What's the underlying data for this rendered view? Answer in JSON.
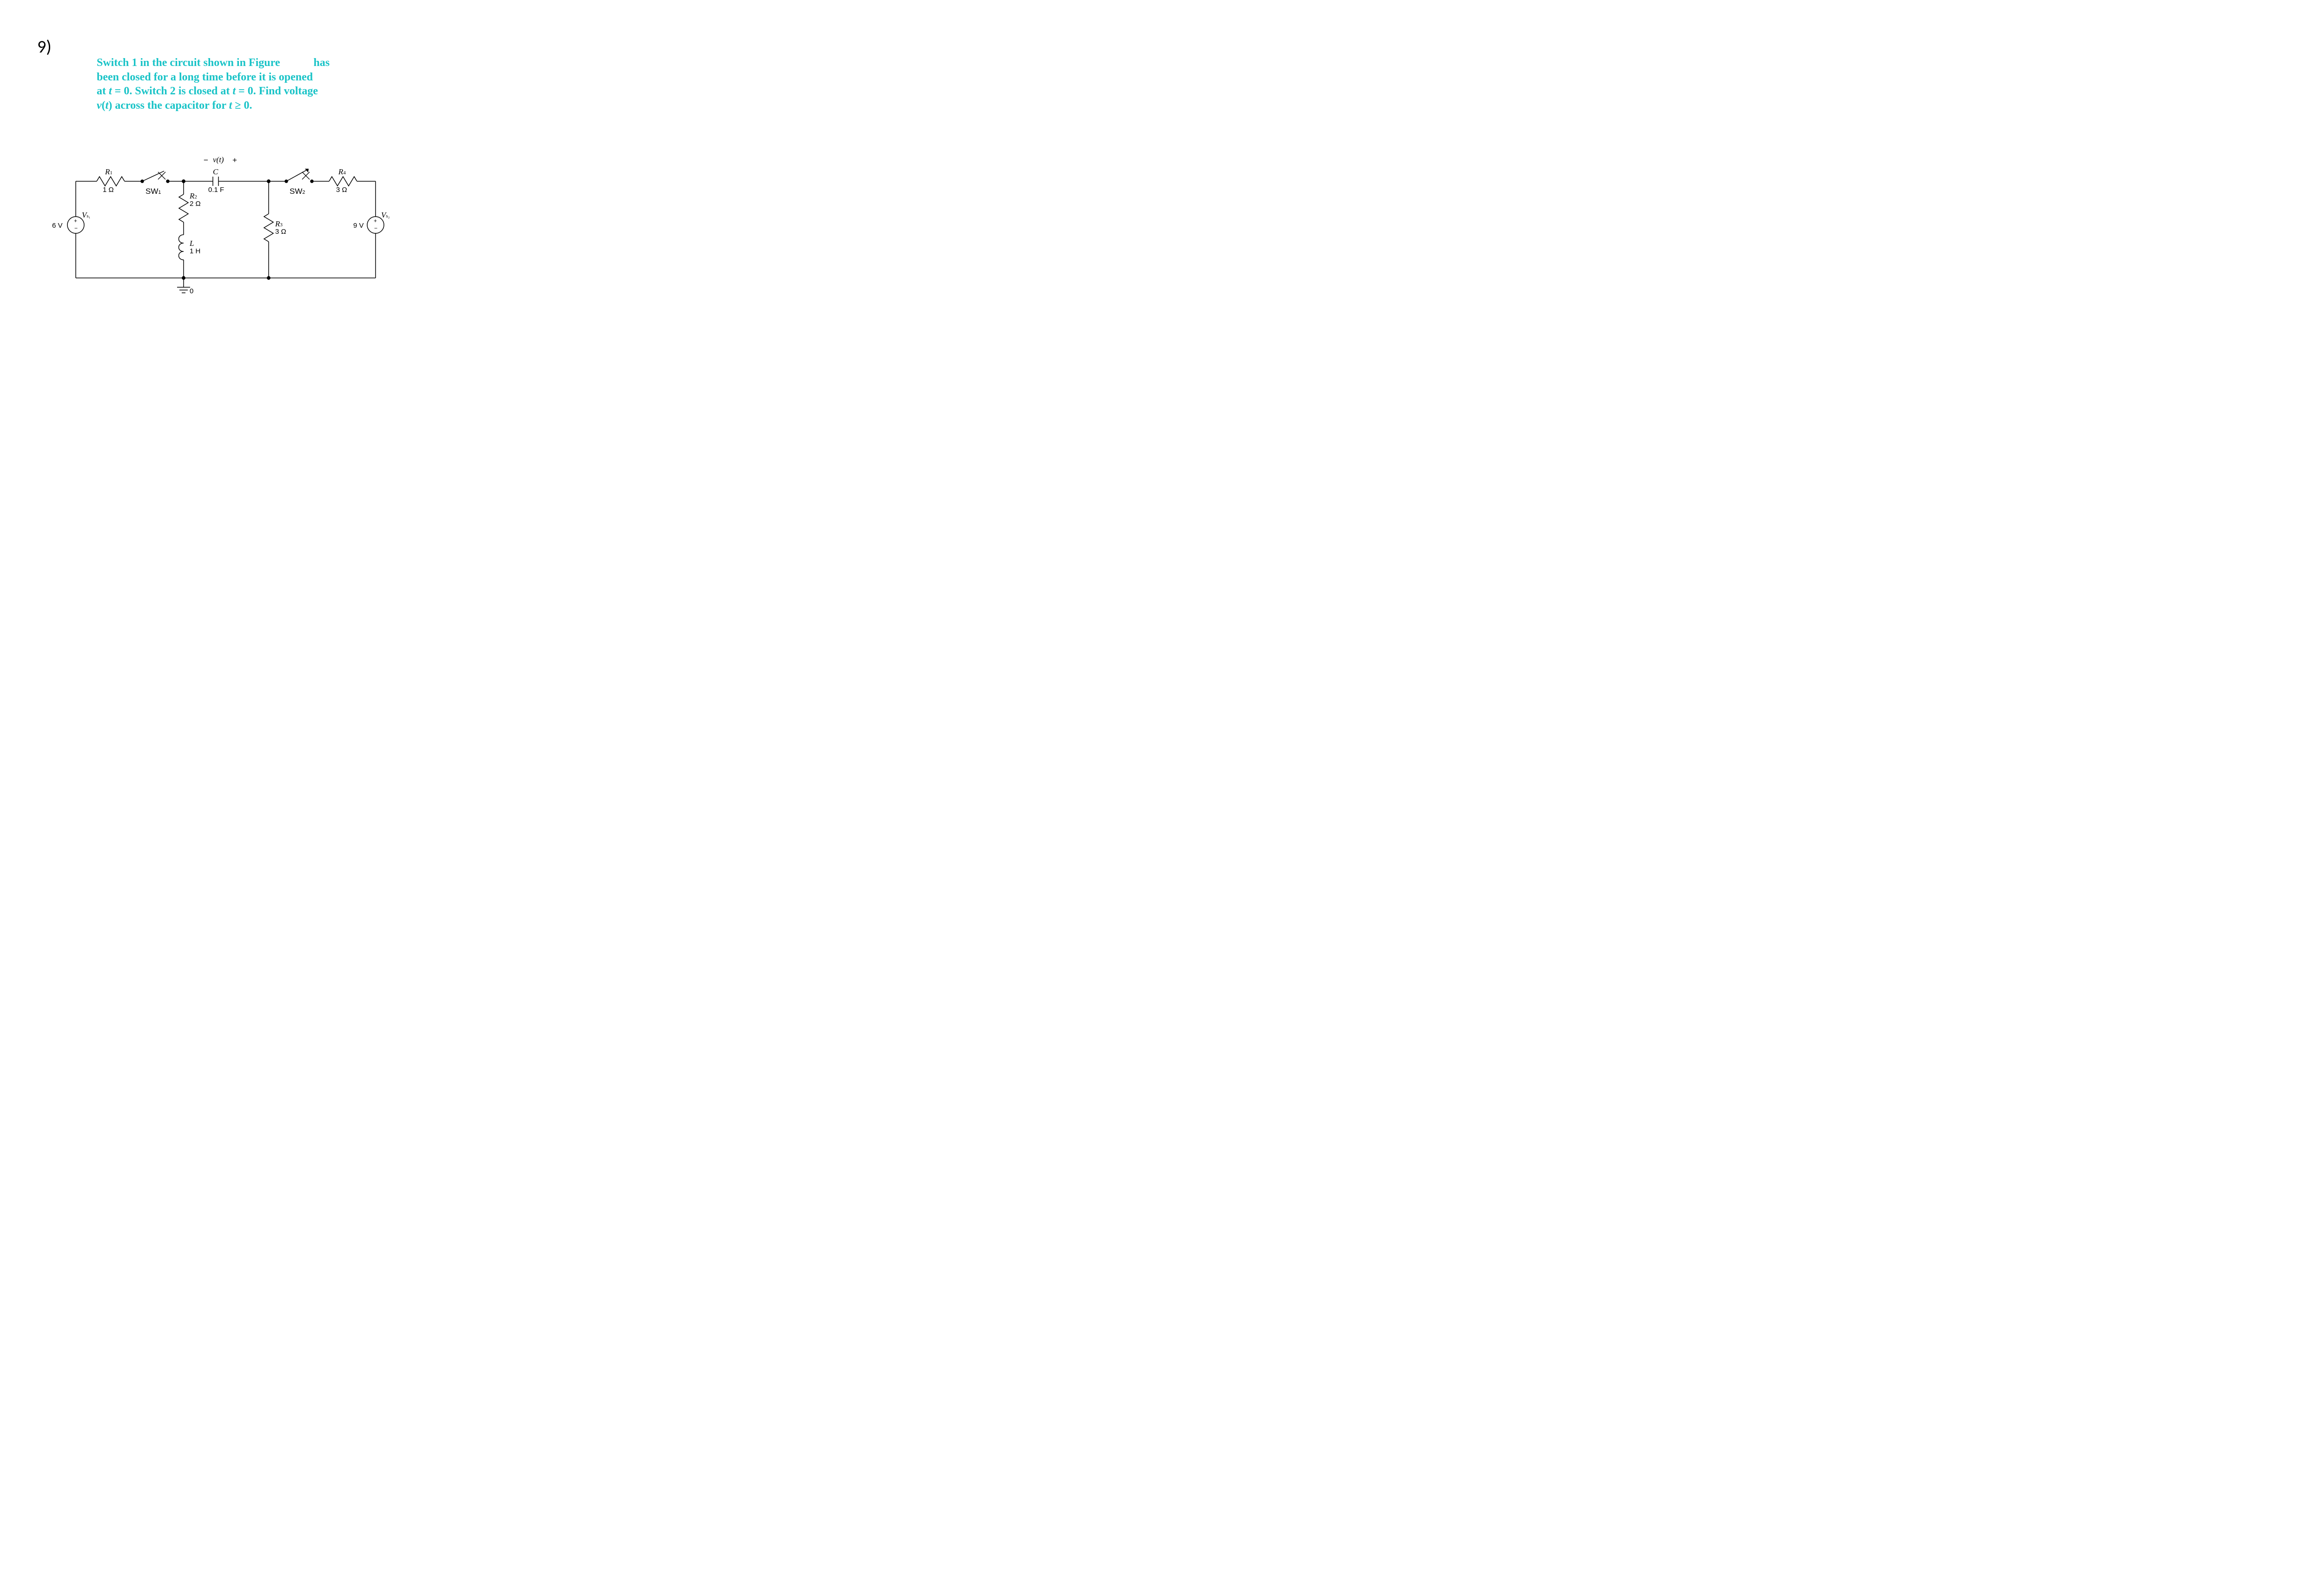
{
  "question_number": "9)",
  "problem": {
    "l1a": "Switch 1 in the circuit shown in Figure",
    "l1b": "has",
    "l2": "been closed for a long time before it is opened",
    "l3a": "at ",
    "l3b": "t",
    "l3c": " = 0. Switch 2 is closed at ",
    "l3d": "t",
    "l3e": " = 0. Find voltage",
    "l4a": "v",
    "l4b": "(",
    "l4c": "t",
    "l4d": ") across the capacitor for ",
    "l4e": "t",
    "l4f": " ≥ 0."
  },
  "circuit": {
    "vt_minus": "−",
    "vt": "v(t)",
    "vt_plus": "+",
    "R1": "R",
    "R1s": "1",
    "R1v": "1 Ω",
    "SW1": "SW",
    "SW1s": "1",
    "C": "C",
    "Cv": "0.1 F",
    "R2": "R",
    "R2s": "2",
    "R2v": "2 Ω",
    "L": "L",
    "Lv": "1 H",
    "R3": "R",
    "R3s": "3",
    "R3v": "3 Ω",
    "SW2": "SW",
    "SW2s": "2",
    "R4": "R",
    "R4s": "4",
    "R4v": "3 Ω",
    "Vs1l": "V",
    "Vs1s": "s₁",
    "Vs1v": "6 V",
    "Vs2l": "V",
    "Vs2s": "s₂",
    "Vs2v": "9 V",
    "gnd": "0"
  }
}
